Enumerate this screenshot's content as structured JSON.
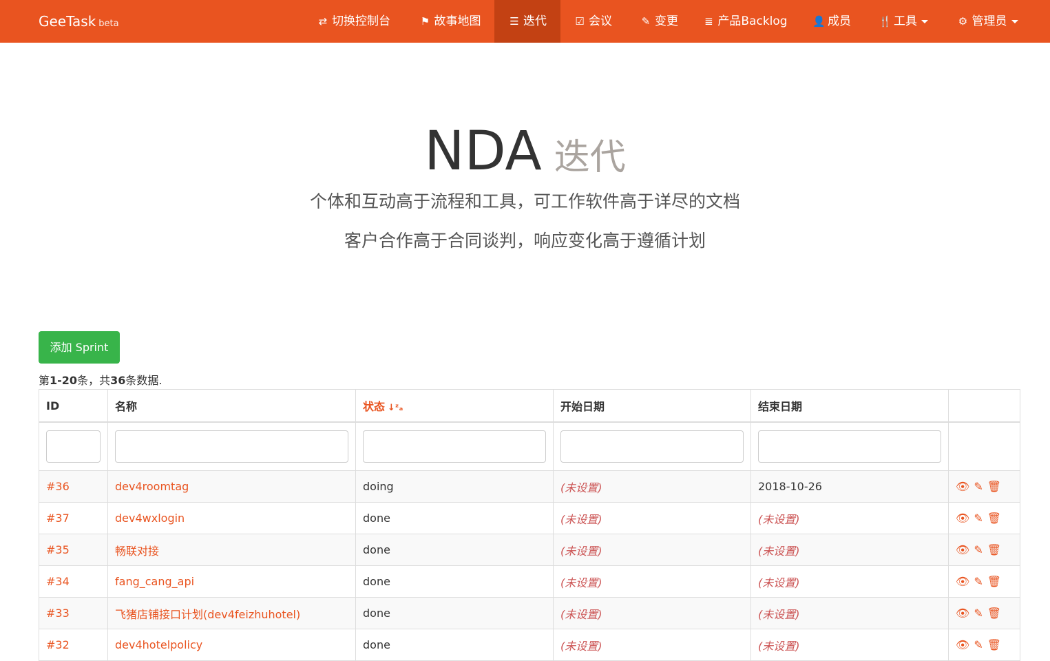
{
  "nav": {
    "brand": "GeeTask",
    "brand_tag": "beta",
    "items": [
      {
        "label": "切换控制台",
        "icon": "refresh-icon",
        "glyph": "⇄"
      },
      {
        "label": "故事地图",
        "icon": "flag-icon",
        "glyph": "⚑"
      },
      {
        "label": "迭代",
        "icon": "tasks-icon",
        "glyph": "☰"
      },
      {
        "label": "会议",
        "icon": "check-square-icon",
        "glyph": "☑"
      },
      {
        "label": "变更",
        "icon": "paperclip-icon",
        "glyph": "✎"
      },
      {
        "label": "产品Backlog",
        "icon": "list-icon",
        "glyph": "≣"
      },
      {
        "label": "成员",
        "icon": "user-icon",
        "glyph": "👤"
      },
      {
        "label": "工具",
        "icon": "cutlery-icon",
        "glyph": "🍴"
      },
      {
        "label": "管理员",
        "icon": "gear-icon",
        "glyph": "⚙"
      }
    ]
  },
  "hero": {
    "title": "NDA",
    "subtitle": "迭代",
    "line1": "个体和互动高于流程和工具，可工作软件高于详尽的文档",
    "line2": "客户合作高于合同谈判，响应变化高于遵循计划"
  },
  "add_button": "添加 Sprint",
  "summary": {
    "prefix": "第",
    "range": "1-20",
    "mid": "条，共",
    "total": "36",
    "suffix": "条数据."
  },
  "table": {
    "headers": [
      "ID",
      "名称",
      "状态",
      "开始日期",
      "结束日期"
    ],
    "sort_icon": "sort-alpha-desc-icon",
    "rows": [
      {
        "id": "#36",
        "name": "dev4roomtag",
        "status": "doing",
        "start": "(未设置)",
        "end": "2018-10-26"
      },
      {
        "id": "#37",
        "name": "dev4wxlogin",
        "status": "done",
        "start": "(未设置)",
        "end": "(未设置)"
      },
      {
        "id": "#35",
        "name": "畅联对接",
        "status": "done",
        "start": "(未设置)",
        "end": "(未设置)"
      },
      {
        "id": "#34",
        "name": "fang_cang_api",
        "status": "done",
        "start": "(未设置)",
        "end": "(未设置)"
      },
      {
        "id": "#33",
        "name": "飞猪店铺接口计划(dev4feizhuhotel)",
        "status": "done",
        "start": "(未设置)",
        "end": "(未设置)"
      },
      {
        "id": "#32",
        "name": "dev4hotelpolicy",
        "status": "done",
        "start": "(未设置)",
        "end": "(未设置)"
      }
    ]
  },
  "colors": {
    "brand": "#e95420",
    "active_nav": "#c34113",
    "success": "#38b44a",
    "not_set": "#cc5555"
  }
}
